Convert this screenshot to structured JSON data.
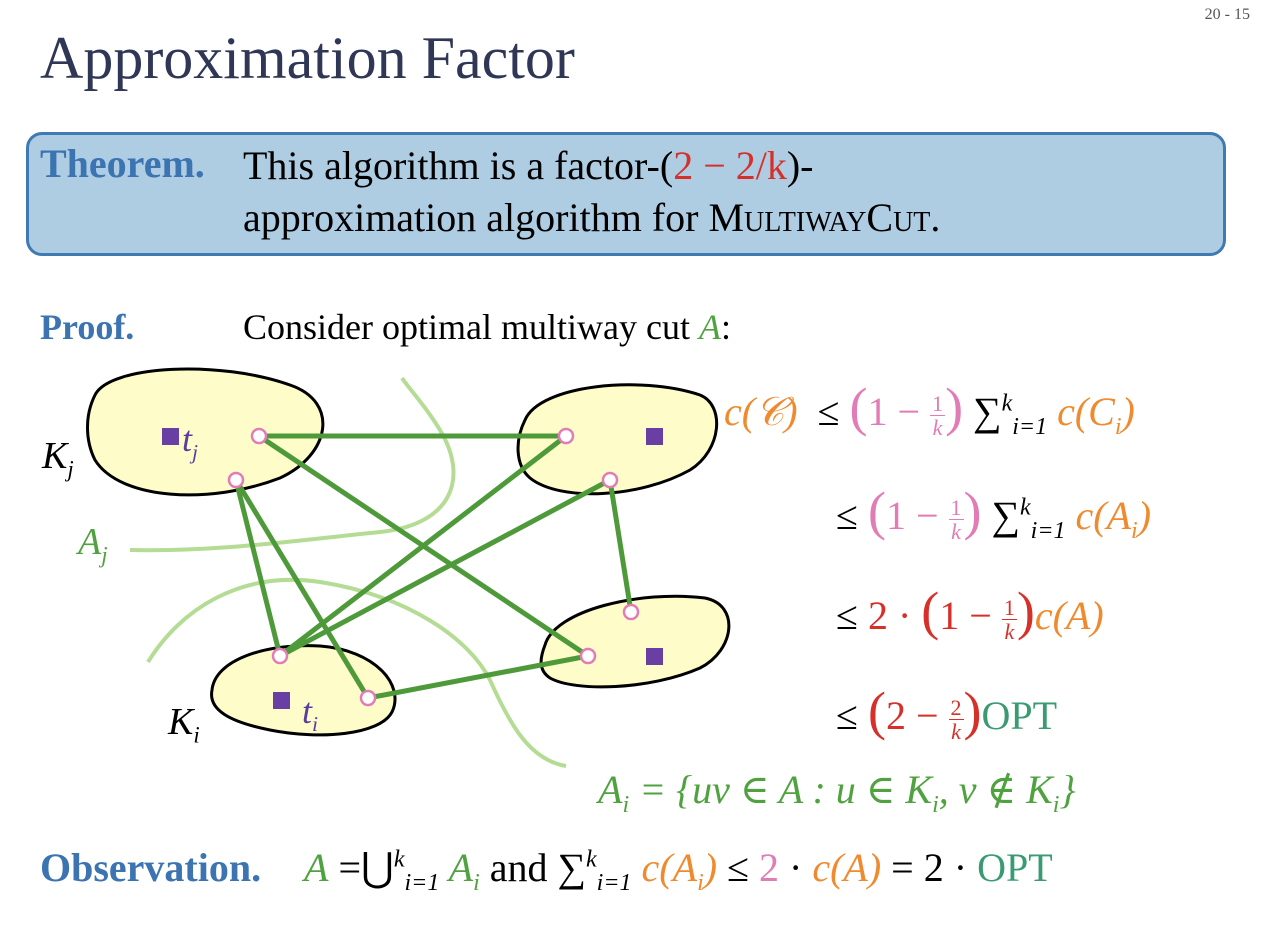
{
  "slide": {
    "page_number": "20 - 15",
    "title": "Approximation Factor"
  },
  "theorem": {
    "label": "Theorem.",
    "line1_prefix": "This algorithm is a factor-(",
    "line1_factor": "2 − 2/k",
    "line1_suffix": ")-",
    "line2_prefix": "approximation algorithm for ",
    "line2_problem": "MultiwayCut",
    "line2_suffix": "."
  },
  "proof": {
    "label": "Proof.",
    "text_prefix": "Consider optimal multiway cut ",
    "text_var": "A",
    "text_suffix": ":"
  },
  "figure": {
    "label_Kj": "K",
    "label_Kj_sub": "j",
    "label_Ki": "K",
    "label_Ki_sub": "i",
    "label_Aj": "A",
    "label_Aj_sub": "j",
    "label_tj": "t",
    "label_tj_sub": "j",
    "label_ti": "t",
    "label_ti_sub": "i"
  },
  "derivation": {
    "lhs": "c(𝒞)",
    "le": "≤",
    "one_minus": "1 −",
    "frac_num": "1",
    "frac_den": "k",
    "sum_sup": "k",
    "sum_sub": "i=1",
    "term1": "c(C",
    "term1_sub": "i",
    "term2": "c(A",
    "term2_sub": "i",
    "close": ")",
    "two_dot": "2 ·",
    "cA": "c(A)",
    "two_minus": "2 −",
    "frac2_num": "2",
    "frac2_den": "k",
    "opt": "OPT"
  },
  "ai_def": {
    "text": "A",
    "sub": "i",
    "rest": " = {uv ∈ A : u ∈ K",
    "rest_sub": "i",
    "rest2": ", v ∉ K",
    "rest2_sub": "i",
    "close": "}"
  },
  "observation": {
    "label": "Observation.",
    "A": "A",
    "eq_union": " =⋃",
    "sup": "k",
    "sub": "i=1",
    "Ai": " A",
    "Ai_sub": "i",
    "and": " and ",
    "sum": "∑",
    "cAi": "c(A",
    "cAi_sub": "i",
    "le": " ≤ ",
    "two": "2",
    "dot": " · ",
    "cA": "c(A)",
    "eq2": " = 2 · ",
    "opt": "OPT"
  }
}
